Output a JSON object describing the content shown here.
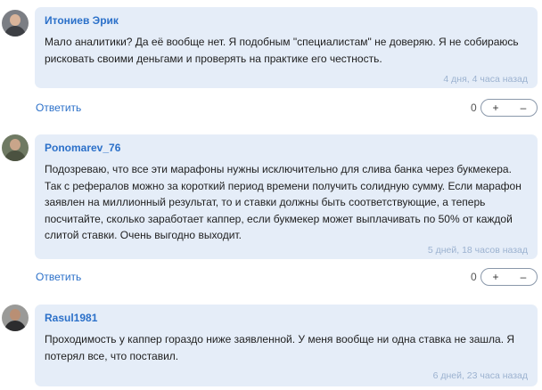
{
  "comments": [
    {
      "author": "Итониев Эрик",
      "text": "Мало аналитики? Да её вообще нет. Я подобным \"специалистам\" не доверяю. Я не собираюсь рисковать своими деньгами и проверять на практике его честность.",
      "time": "4 дня, 4 часа назад",
      "reply": "Ответить",
      "count": "0",
      "plus": "+",
      "minus": "–"
    },
    {
      "author": "Ponomarev_76",
      "text": "Подозреваю, что все эти марафоны нужны исключительно для слива банка через букмекера. Так с рефералов можно за короткий период времени получить солидную сумму. Если марафон заявлен на миллионный результат, то и ставки должны быть соответствующие, а теперь посчитайте, сколько заработает каппер, если букмекер может выплачивать по 50% от каждой слитой ставки. Очень выгодно выходит.",
      "time": "5 дней, 18 часов назад",
      "reply": "Ответить",
      "count": "0",
      "plus": "+",
      "minus": "–"
    },
    {
      "author": "Rasul1981",
      "text": "Проходимость у каппер гораздо ниже заявленной. У меня вообще ни одна ставка не зашла. Я потерял все, что поставил.",
      "time": "6 дней, 23 часа назад"
    }
  ],
  "colors": {
    "bubble": "#e5edf8",
    "author": "#2b70c9",
    "time": "#9cb2d0"
  }
}
